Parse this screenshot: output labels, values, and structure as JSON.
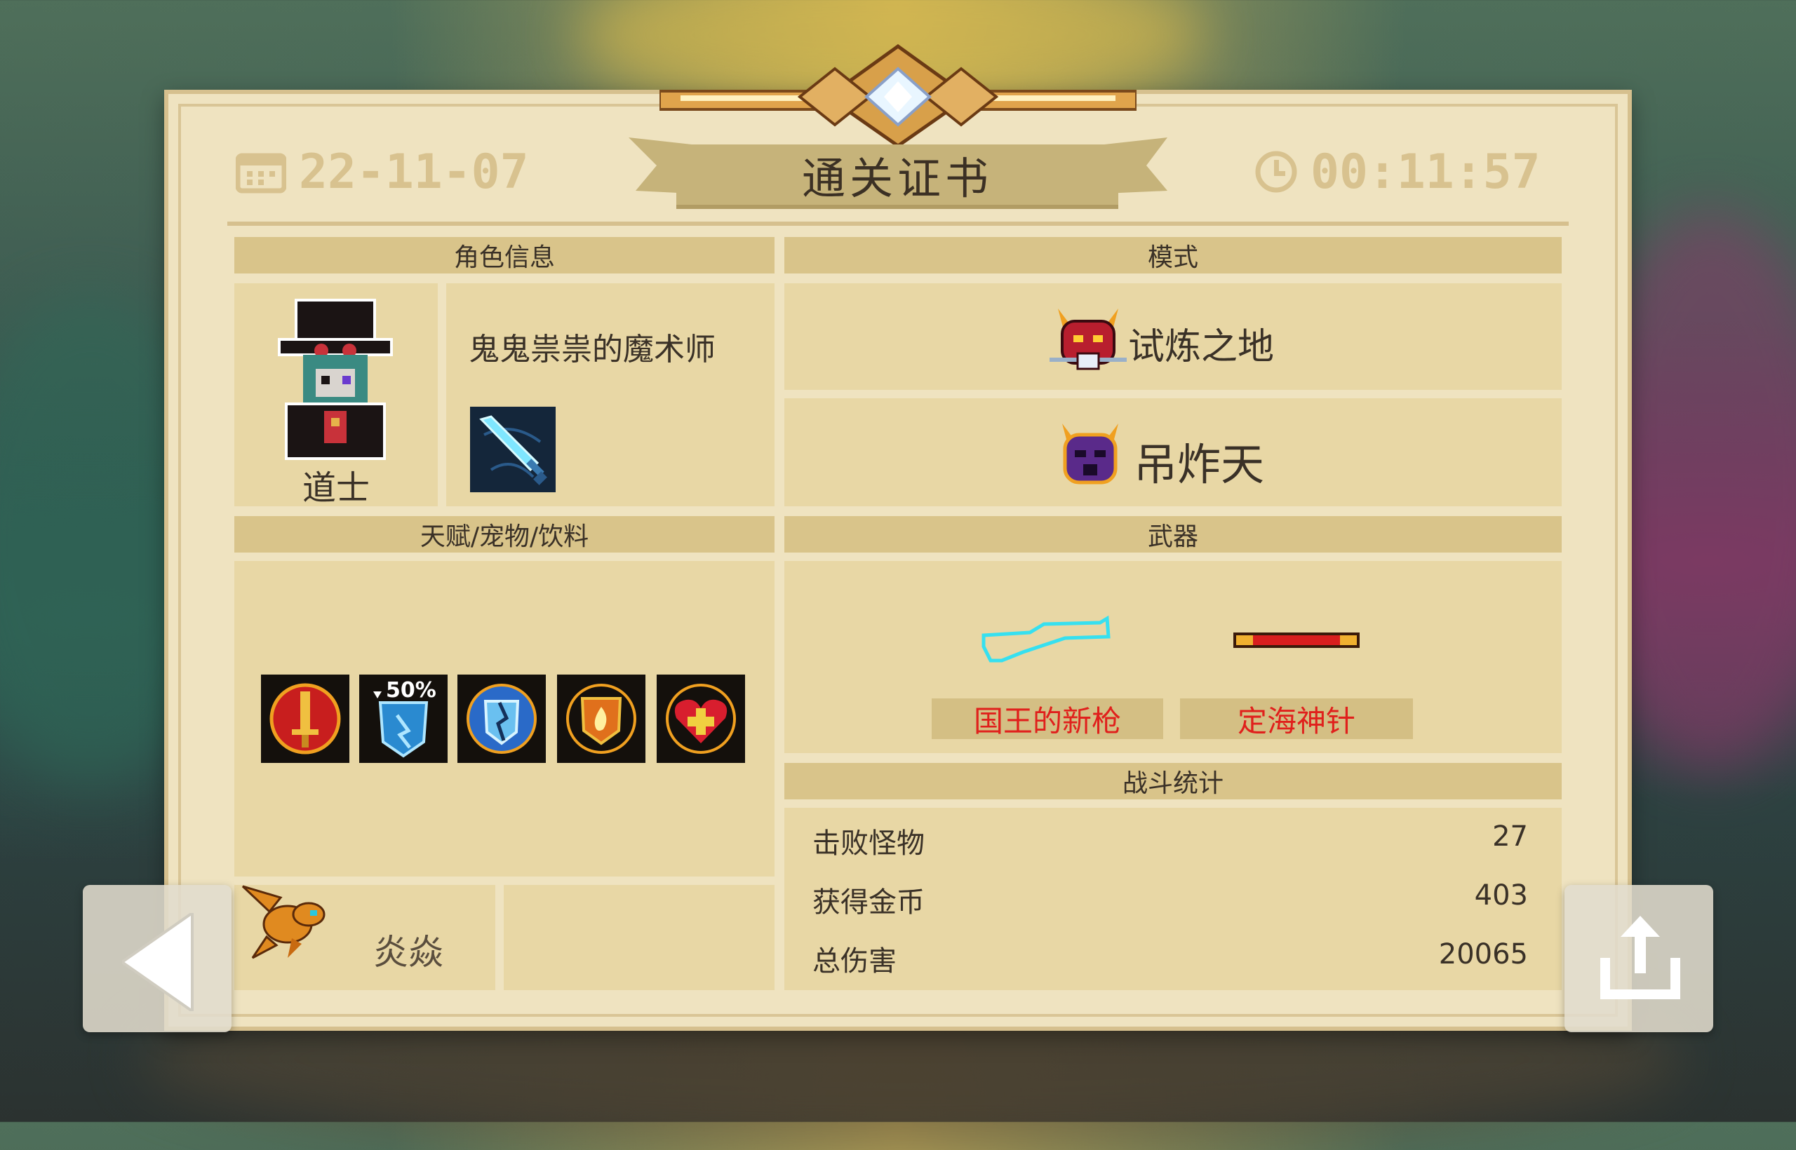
{
  "header": {
    "date": "22-11-07",
    "title": "通关证书",
    "time": "00:11:57"
  },
  "character_info": {
    "header": "角色信息",
    "class_name": "道士",
    "skin_name": "鬼鬼祟祟的魔术师"
  },
  "mode": {
    "header": "模式",
    "items": [
      "试炼之地",
      "吊炸天"
    ]
  },
  "talents": {
    "header": "天赋/宠物/饮料",
    "badge_text": "50%",
    "pet_name": "炎焱"
  },
  "weapons": {
    "header": "武器",
    "items": [
      "国王的新枪",
      "定海神针"
    ]
  },
  "combat_stats": {
    "header": "战斗统计",
    "rows": [
      {
        "label": "击败怪物",
        "value": "27"
      },
      {
        "label": "获得金币",
        "value": "403"
      },
      {
        "label": "总伤害",
        "value": "20065"
      }
    ]
  },
  "colors": {
    "card": "#efe3c0",
    "panel": "#e8d7a5",
    "header_bar": "#d9c48a",
    "weapon_name": "#e0201c",
    "gold_accent": "#d6a44a"
  },
  "icons": {
    "back": "back-triangle-icon",
    "share": "share-icon",
    "calendar": "calendar-icon",
    "clock": "clock-icon"
  }
}
